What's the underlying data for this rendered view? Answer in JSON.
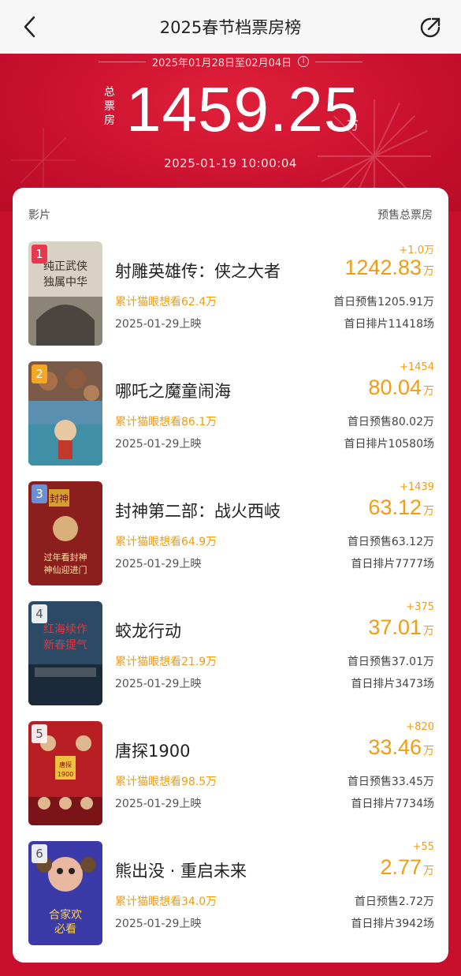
{
  "nav": {
    "title": "2025春节档票房榜",
    "back_icon": "chevron-left-icon",
    "share_icon": "share-icon"
  },
  "hero": {
    "date_range": "2025年01月28日至02月04日",
    "total_label": "总票房",
    "total_value": "1459.25",
    "total_unit": "万",
    "update_time": "2025-01-19  10:00:04"
  },
  "table": {
    "col_movie": "影片",
    "col_presale": "预售总票房"
  },
  "movies": [
    {
      "rank": "1",
      "title": "射雕英雄传：侠之大者",
      "wish": "累计猫眼想看62.4万",
      "date": "2025-01-29上映",
      "delta": "+1.0万",
      "presale": "1242.83",
      "unit": "万",
      "firstday": "首日预售1205.91万",
      "shows": "首日排片11418场",
      "poster_text": "纯正武侠 独属中华"
    },
    {
      "rank": "2",
      "title": "哪吒之魔童闹海",
      "wish": "累计猫眼想看86.1万",
      "date": "2025-01-29上映",
      "delta": "+1454",
      "presale": "80.04",
      "unit": "万",
      "firstday": "首日预售80.02万",
      "shows": "首日排片10580场",
      "poster_text": ""
    },
    {
      "rank": "3",
      "title": "封神第二部：战火西岐",
      "wish": "累计猫眼想看64.9万",
      "date": "2025-01-29上映",
      "delta": "+1439",
      "presale": "63.12",
      "unit": "万",
      "firstday": "首日预售63.12万",
      "shows": "首日排片7777场",
      "poster_text": "过年看封神 神仙迎进门"
    },
    {
      "rank": "4",
      "title": "蛟龙行动",
      "wish": "累计猫眼想看21.9万",
      "date": "2025-01-29上映",
      "delta": "+375",
      "presale": "37.01",
      "unit": "万",
      "firstday": "首日预售37.01万",
      "shows": "首日排片3473场",
      "poster_text": "红海续作 新春提气"
    },
    {
      "rank": "5",
      "title": "唐探1900",
      "wish": "累计猫眼想看98.5万",
      "date": "2025-01-29上映",
      "delta": "+820",
      "presale": "33.46",
      "unit": "万",
      "firstday": "首日预售33.45万",
      "shows": "首日排片7734场",
      "poster_text": "唐探1900"
    },
    {
      "rank": "6",
      "title": "熊出没 · 重启未来",
      "wish": "累计猫眼想看34.0万",
      "date": "2025-01-29上映",
      "delta": "+55",
      "presale": "2.77",
      "unit": "万",
      "firstday": "首日预售2.72万",
      "shows": "首日排片3942场",
      "poster_text": "合家欢 必看"
    }
  ]
}
